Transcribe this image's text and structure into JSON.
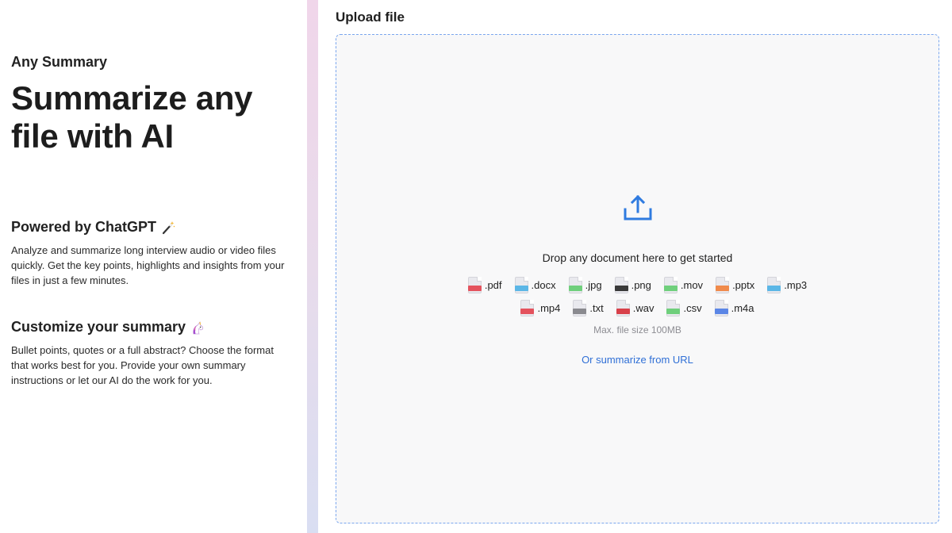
{
  "brand": "Any Summary",
  "hero": "Summarize any file with AI",
  "sections": [
    {
      "title": "Powered by ChatGPT",
      "emoji": "magic-wand-icon",
      "body": "Analyze and summarize long interview audio or video files quickly. Get the key points, highlights and insights from your files in just a few minutes."
    },
    {
      "title": "Customize your summary",
      "emoji": "unicorn-icon",
      "body": "Bullet points, quotes or a full abstract? Choose the format that works best for you. Provide your own summary instructions or let our AI do the work for you."
    }
  ],
  "upload": {
    "title": "Upload file",
    "drop_text": "Drop any document here to get started",
    "max_size": "Max. file size 100MB",
    "url_link": "Or summarize from URL",
    "accent": "#2f6fd6",
    "file_types_row1": [
      {
        "ext": ".pdf",
        "color": "#e4525d"
      },
      {
        "ext": ".docx",
        "color": "#5bb6e6"
      },
      {
        "ext": ".jpg",
        "color": "#6fcf7c"
      },
      {
        "ext": ".png",
        "color": "#3a3a3a"
      },
      {
        "ext": ".mov",
        "color": "#6fcf7c"
      },
      {
        "ext": ".pptx",
        "color": "#f08a4b"
      },
      {
        "ext": ".mp3",
        "color": "#5bb6e6"
      }
    ],
    "file_types_row2": [
      {
        "ext": ".mp4",
        "color": "#e4525d"
      },
      {
        "ext": ".txt",
        "color": "#8a8a8f"
      },
      {
        "ext": ".wav",
        "color": "#d8404a"
      },
      {
        "ext": ".csv",
        "color": "#6fcf7c"
      },
      {
        "ext": ".m4a",
        "color": "#5b86e6"
      }
    ]
  }
}
